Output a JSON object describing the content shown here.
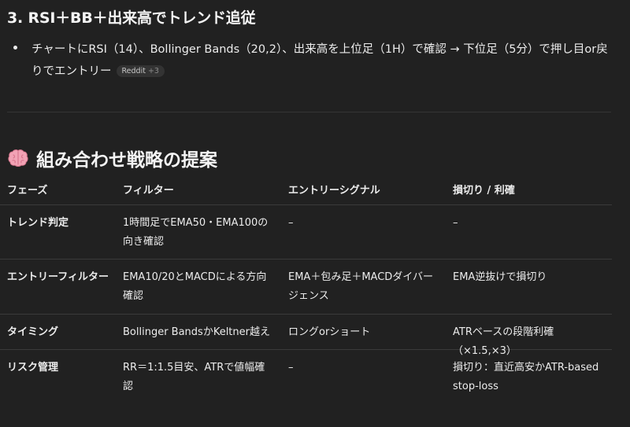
{
  "section3": {
    "heading": "3. RSI＋BB＋出来高でトレンド追従",
    "bullet_text": "チャートにRSI（14）、Bollinger Bands（20,2）、出来高を上位足（1H）で確認 → 下位足（5分）で押し目or戻りでエントリー",
    "source_pill": {
      "label": "Reddit",
      "extra": "+3"
    }
  },
  "proposal": {
    "icon": "brain-icon",
    "heading": "組み合わせ戦略の提案"
  },
  "table": {
    "headers": [
      "フェーズ",
      "フィルター",
      "エントリーシグナル",
      "損切り / 利確"
    ],
    "rows": [
      [
        "トレンド判定",
        "1時間足でEMA50・EMA100の向き確認",
        "–",
        "–"
      ],
      [
        "エントリーフィルター",
        "EMA10/20とMACDによる方向確認",
        "EMA＋包み足＋MACDダイバージェンス",
        "EMA逆抜けで損切り"
      ],
      [
        "タイミング",
        "Bollinger BandsかKeltner越え",
        "ロングorショート",
        "ATRベースの段階利確（×1.5,×3）"
      ],
      [
        "リスク管理",
        "RR＝1:1.5目安、ATRで値幅確認",
        "–",
        "損切り：直近高安かATR-based stop-loss"
      ]
    ]
  }
}
